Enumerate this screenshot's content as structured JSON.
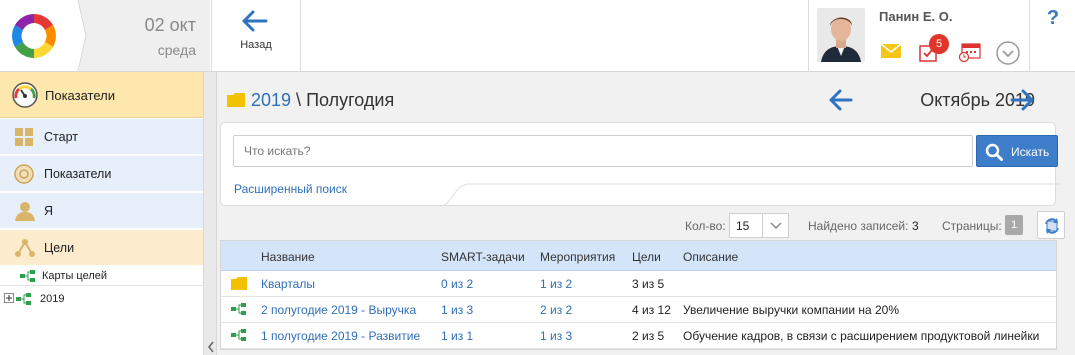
{
  "header": {
    "date_day": "02 окт",
    "date_weekday": "среда",
    "back_label": "Назад",
    "user_name": "Панин Е. О.",
    "tasks_badge": "5",
    "help_label": "?"
  },
  "sidebar": {
    "section_title": "Показатели",
    "items": [
      {
        "label": "Старт"
      },
      {
        "label": "Показатели"
      },
      {
        "label": "Я"
      },
      {
        "label": "Цели"
      }
    ],
    "tree": [
      {
        "label": "Карты целей"
      },
      {
        "label": "2019"
      }
    ]
  },
  "main": {
    "breadcrumb_link": "2019",
    "breadcrumb_separator": " \\ ",
    "breadcrumb_current": "Полугодия",
    "period": "Октябрь 2019",
    "search": {
      "placeholder": "Что искать?",
      "value": "",
      "button_label": "Искать",
      "advanced_link": "Расширенный поиск"
    },
    "pager": {
      "count_label": "Кол-во:",
      "count_value": "15",
      "found_label": "Найдено записей:",
      "found_value": "3",
      "pages_label": "Страницы:",
      "page_current": "1"
    },
    "table": {
      "columns": [
        "Название",
        "SMART-задачи",
        "Мероприятия",
        "Цели",
        "Описание"
      ],
      "rows": [
        {
          "type": "folder",
          "name": "Кварталы",
          "smart": "0 из 2",
          "events": "1 из 2",
          "goals": "3 из 5",
          "desc": ""
        },
        {
          "type": "map",
          "name": "2 полугодие 2019 - Выручка",
          "smart": "1 из 3",
          "events": "2 из 2",
          "goals": "4 из 12",
          "desc": "Увеличение выручки компании на 20%"
        },
        {
          "type": "map",
          "name": "1 полугодие 2019 - Развитие",
          "smart": "1 из 1",
          "events": "1 из 3",
          "goals": "2 из 5",
          "desc": "Обучение кадров, в связи с расширением продуктовой линейки"
        }
      ]
    }
  },
  "colors": {
    "accent": "#3d7dc9",
    "link": "#2f6fb8",
    "badge": "#e0352b",
    "sidebar_active": "#fde7ac",
    "sidebar_item": "#e6effa",
    "table_header": "#d4e5fa"
  },
  "icons": [
    "app-logo-icon",
    "back-arrow-icon",
    "mail-icon",
    "tasks-icon",
    "calendar-icon",
    "chevron-down-circle-icon",
    "help-icon",
    "gauge-icon",
    "grid-icon",
    "user-icon",
    "goals-icon",
    "tree-map-icon",
    "folder-icon",
    "search-icon",
    "refresh-icon"
  ]
}
